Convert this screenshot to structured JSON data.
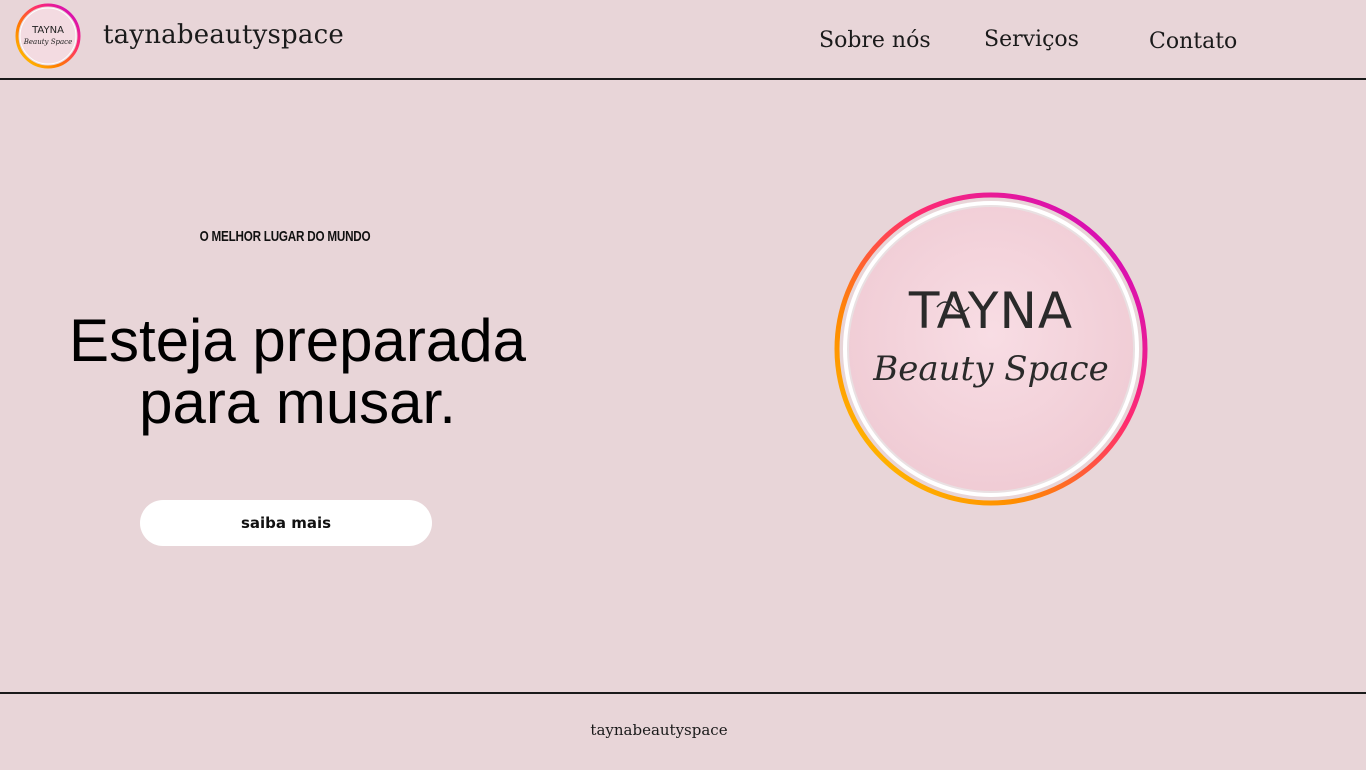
{
  "header": {
    "brand": "taynabeautyspace",
    "nav": [
      "Sobre nós",
      "Serviços",
      "Contato"
    ]
  },
  "hero": {
    "eyebrow": "O MELHOR LUGAR DO MUNDO",
    "headline": "Esteja preparada para musar.",
    "cta_label": "saiba mais"
  },
  "logo": {
    "title": "TAYNA",
    "script": "Beauty Space",
    "ring_colors": [
      "#ffd200",
      "#ff7a00",
      "#ff2d6f",
      "#c400d6"
    ]
  },
  "footer": {
    "text": "taynabeautyspace"
  }
}
